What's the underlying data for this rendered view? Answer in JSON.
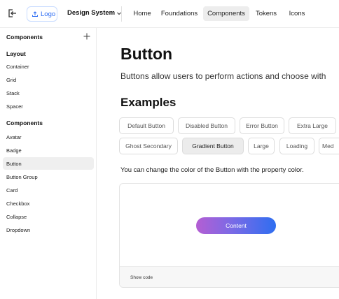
{
  "header": {
    "logo_label": "Logo",
    "design_system_label": "Design System",
    "nav": [
      "Home",
      "Foundations",
      "Components",
      "Tokens",
      "Icons"
    ],
    "active_nav": "Components"
  },
  "sidebar": {
    "title": "Components",
    "groups": [
      {
        "heading": "Layout",
        "items": [
          "Container",
          "Grid",
          "Stack",
          "Spacer"
        ]
      },
      {
        "heading": "Components",
        "items": [
          "Avatar",
          "Badge",
          "Button",
          "Button Group",
          "Card",
          "Checkbox",
          "Collapse",
          "Dropdown"
        ]
      }
    ],
    "active_item": "Button"
  },
  "main": {
    "title": "Button",
    "description": "Buttons allow users to perform actions and choose with",
    "examples_heading": "Examples",
    "example_buttons_row1": [
      "Default Button",
      "Disabled Button",
      "Error Button",
      "Extra Large"
    ],
    "example_buttons_row2": [
      "Ghost Secondary",
      "Gradient Button",
      "Large",
      "Loading",
      "Med"
    ],
    "selected_example": "Gradient Button",
    "helper_text": "You can change the color of the Button with the property color.",
    "demo_button_label": "Content",
    "show_code_label": "Show code"
  },
  "colors": {
    "accent": "#2b6bf3",
    "gradient_start": "#b45ed3",
    "gradient_end": "#2f6ef0",
    "active_bg": "#ededed"
  },
  "icons": {
    "collapse": "sidebar-collapse-icon",
    "logo": "upload-icon",
    "dropdown": "chevron-down-icon",
    "add": "plus-icon"
  }
}
